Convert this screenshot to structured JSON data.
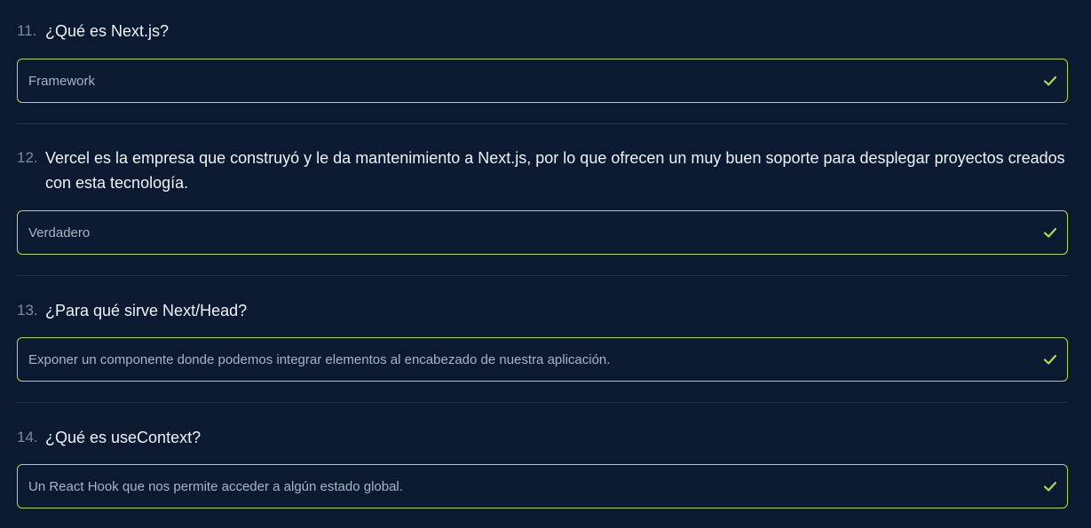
{
  "questions": [
    {
      "number": "11.",
      "text": "¿Qué es Next.js?",
      "answer": "Framework",
      "status_icon": "check-icon"
    },
    {
      "number": "12.",
      "text": "Vercel es la empresa que construyó y le da mantenimiento a Next.js, por lo que ofrecen un muy buen soporte para desplegar proyectos creados con esta tecnología.",
      "answer": "Verdadero",
      "status_icon": "check-icon"
    },
    {
      "number": "13.",
      "text": "¿Para qué sirve Next/Head?",
      "answer": "Exponer un componente donde podemos integrar elementos al encabezado de nuestra aplicación.",
      "status_icon": "check-icon"
    },
    {
      "number": "14.",
      "text": "¿Qué es useContext?",
      "answer": "Un React Hook que nos permite acceder a algún estado global.",
      "status_icon": "check-icon"
    }
  ],
  "colors": {
    "background": "#0b1a30",
    "divider": "#24334a",
    "answer_border": "#b7d94c",
    "check": "#b7d94c",
    "question_text": "#eef2f8",
    "number_text": "#7d8aa0",
    "answer_text": "#a9b4c4"
  }
}
